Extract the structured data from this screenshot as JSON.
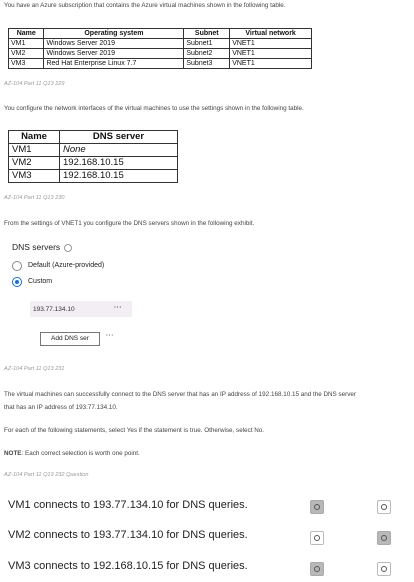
{
  "intro": "You have an Azure subscription that contains the Azure virtual machines shown in the following table.",
  "vm_table": {
    "headers": [
      "Name",
      "Operating system",
      "Subnet",
      "Virtual network"
    ],
    "rows": [
      [
        "VM1",
        "Windows Server 2019",
        "Subnet1",
        "VNET1"
      ],
      [
        "VM2",
        "Windows Server 2019",
        "Subnet2",
        "VNET1"
      ],
      [
        "VM3",
        "Red Hat Enterprise Linux 7.7",
        "Subnet3",
        "VNET1"
      ]
    ]
  },
  "part1": "AZ-104 Part 11 Q13 229",
  "config_text": "You configure the network interfaces of the virtual machines to use the settings shown in the following table.",
  "nic_table": {
    "headers": [
      "Name",
      "DNS server"
    ],
    "rows": [
      [
        "VM1",
        "None"
      ],
      [
        "VM2",
        "192.168.10.15"
      ],
      [
        "VM3",
        "192.168.10.15"
      ]
    ]
  },
  "part2": "AZ-104 Part 11 Q13 230",
  "vnet_text": "From the settings of VNET1 you configure the DNS servers shown in the following exhibit.",
  "dns_panel": {
    "title": "DNS servers",
    "option_default": "Default (Azure-provided)",
    "option_custom": "Custom",
    "selected": "Custom",
    "server_ip": "193.77.134.10",
    "ellipsis": "···",
    "add_button": "Add DNS ser"
  },
  "part3": "AZ-104 Part 11 Q13 231",
  "desc_line1": "The virtual machines can successfully connect to the DNS server that has an IP address of 192.168.10.15 and the DNS server",
  "desc_line2": "that has an IP address of 193.77.134.10.",
  "instruction": "For each of the following statements, select Yes if the statement is true. Otherwise, select No.",
  "note_label": "NOTE",
  "note_text": ": Each correct selection is worth one point.",
  "part4": "AZ-104 Part 11 Q13 232 Question",
  "statements": [
    {
      "text": "VM1 connects to 193.77.134.10 for DNS queries.",
      "yes_selected": true,
      "no_selected": false
    },
    {
      "text": "VM2 connects to 193.77.134.10 for DNS queries.",
      "yes_selected": false,
      "no_selected": true
    },
    {
      "text": "VM3 connects to 192.168.10.15 for DNS queries.",
      "yes_selected": true,
      "no_selected": false
    }
  ]
}
